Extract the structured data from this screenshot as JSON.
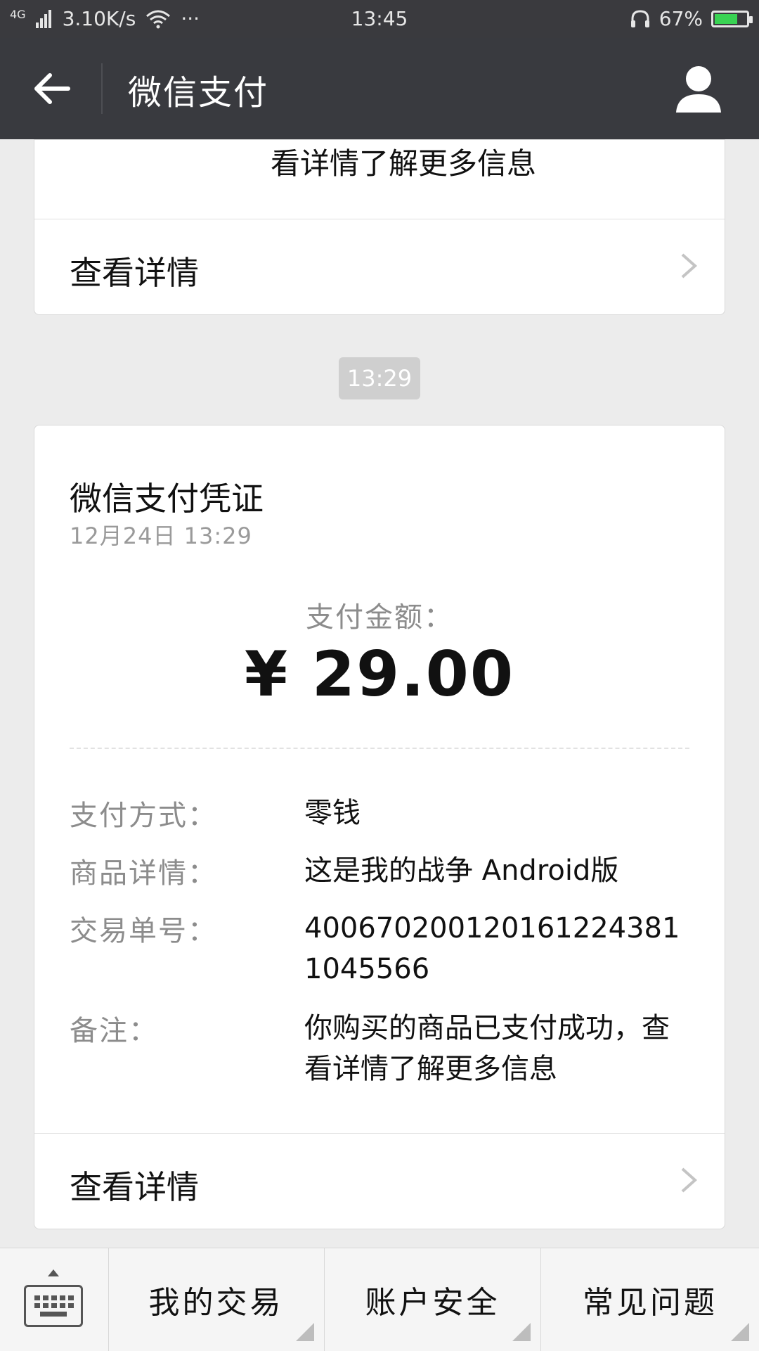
{
  "status_bar": {
    "network": "4G",
    "speed": "3.10K/s",
    "dots": "···",
    "time": "13:45",
    "battery": "67%"
  },
  "header": {
    "title": "微信支付"
  },
  "prev_card": {
    "snippet": "看详情了解更多信息",
    "link_label": "查看详情"
  },
  "time_badge": "13:29",
  "receipt": {
    "title": "微信支付凭证",
    "date": "12月24日  13:29",
    "amount_label": "支付金额：",
    "amount": "¥ 29.00",
    "fields": [
      {
        "label": "支付方式：",
        "value": "零钱"
      },
      {
        "label": "商品详情：",
        "value": "这是我的战争 Android版"
      },
      {
        "label": "交易单号：",
        "value": "4006702001201612243811045566"
      },
      {
        "label": "备注：",
        "value": "你购买的商品已支付成功，查看详情了解更多信息"
      }
    ],
    "link_label": "查看详情"
  },
  "bottom_menu": {
    "items": [
      "我的交易",
      "账户安全",
      "常见问题"
    ]
  }
}
